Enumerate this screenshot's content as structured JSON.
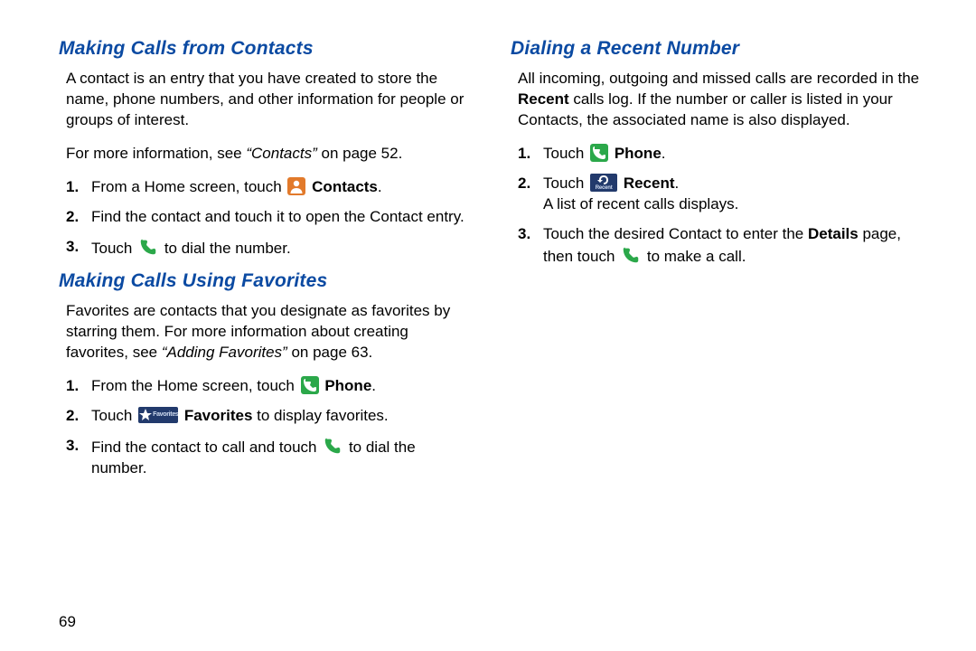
{
  "page_number": "69",
  "left": {
    "section_a_title": "Making Calls from Contacts",
    "section_a_intro": "A contact is an entry that you have created to store the name, phone numbers, and other information for people or groups of interest.",
    "section_a_more_pre": "For more information, see ",
    "section_a_more_ref": "“Contacts”",
    "section_a_more_post": " on page 52.",
    "a_step1_pre": "From a Home screen, touch ",
    "a_step1_label": "Contacts",
    "a_step1_post": ".",
    "a_step2": "Find the contact and touch it to open the Contact entry.",
    "a_step3_pre": "Touch ",
    "a_step3_post": " to dial the number.",
    "section_b_title": "Making Calls Using Favorites",
    "section_b_intro_pre": "Favorites are contacts that you designate as favorites by starring them. For more information about creating favorites, see ",
    "section_b_intro_ref": "“Adding Favorites”",
    "section_b_intro_post": " on page 63.",
    "b_step1_pre": "From the Home screen, touch ",
    "b_step1_label": "Phone",
    "b_step1_post": ".",
    "b_step2_pre": "Touch ",
    "b_step2_label": "Favorites",
    "b_step2_post": " to display favorites.",
    "b_step3_pre": "Find the contact to call and touch ",
    "b_step3_post": " to dial the number."
  },
  "right": {
    "section_c_title": "Dialing a Recent Number",
    "c_intro_pre": "All incoming, outgoing and missed calls are recorded in the ",
    "c_intro_bold": "Recent",
    "c_intro_post": " calls log. If the number or caller is listed in your Contacts, the associated name is also displayed.",
    "c_step1_pre": "Touch ",
    "c_step1_label": "Phone",
    "c_step1_post": ".",
    "c_step2_pre": "Touch ",
    "c_step2_label": "Recent",
    "c_step2_post": ".",
    "c_step2_follow": "A list of recent calls displays.",
    "c_step3_pre": "Touch the desired Contact to enter the ",
    "c_step3_bold": "Details",
    "c_step3_mid": " page, then touch ",
    "c_step3_post": " to make a call."
  },
  "icons": {
    "favorites_badge": "Favorites",
    "recent_badge": "Recent"
  },
  "nums": {
    "n1": "1.",
    "n2": "2.",
    "n3": "3."
  }
}
